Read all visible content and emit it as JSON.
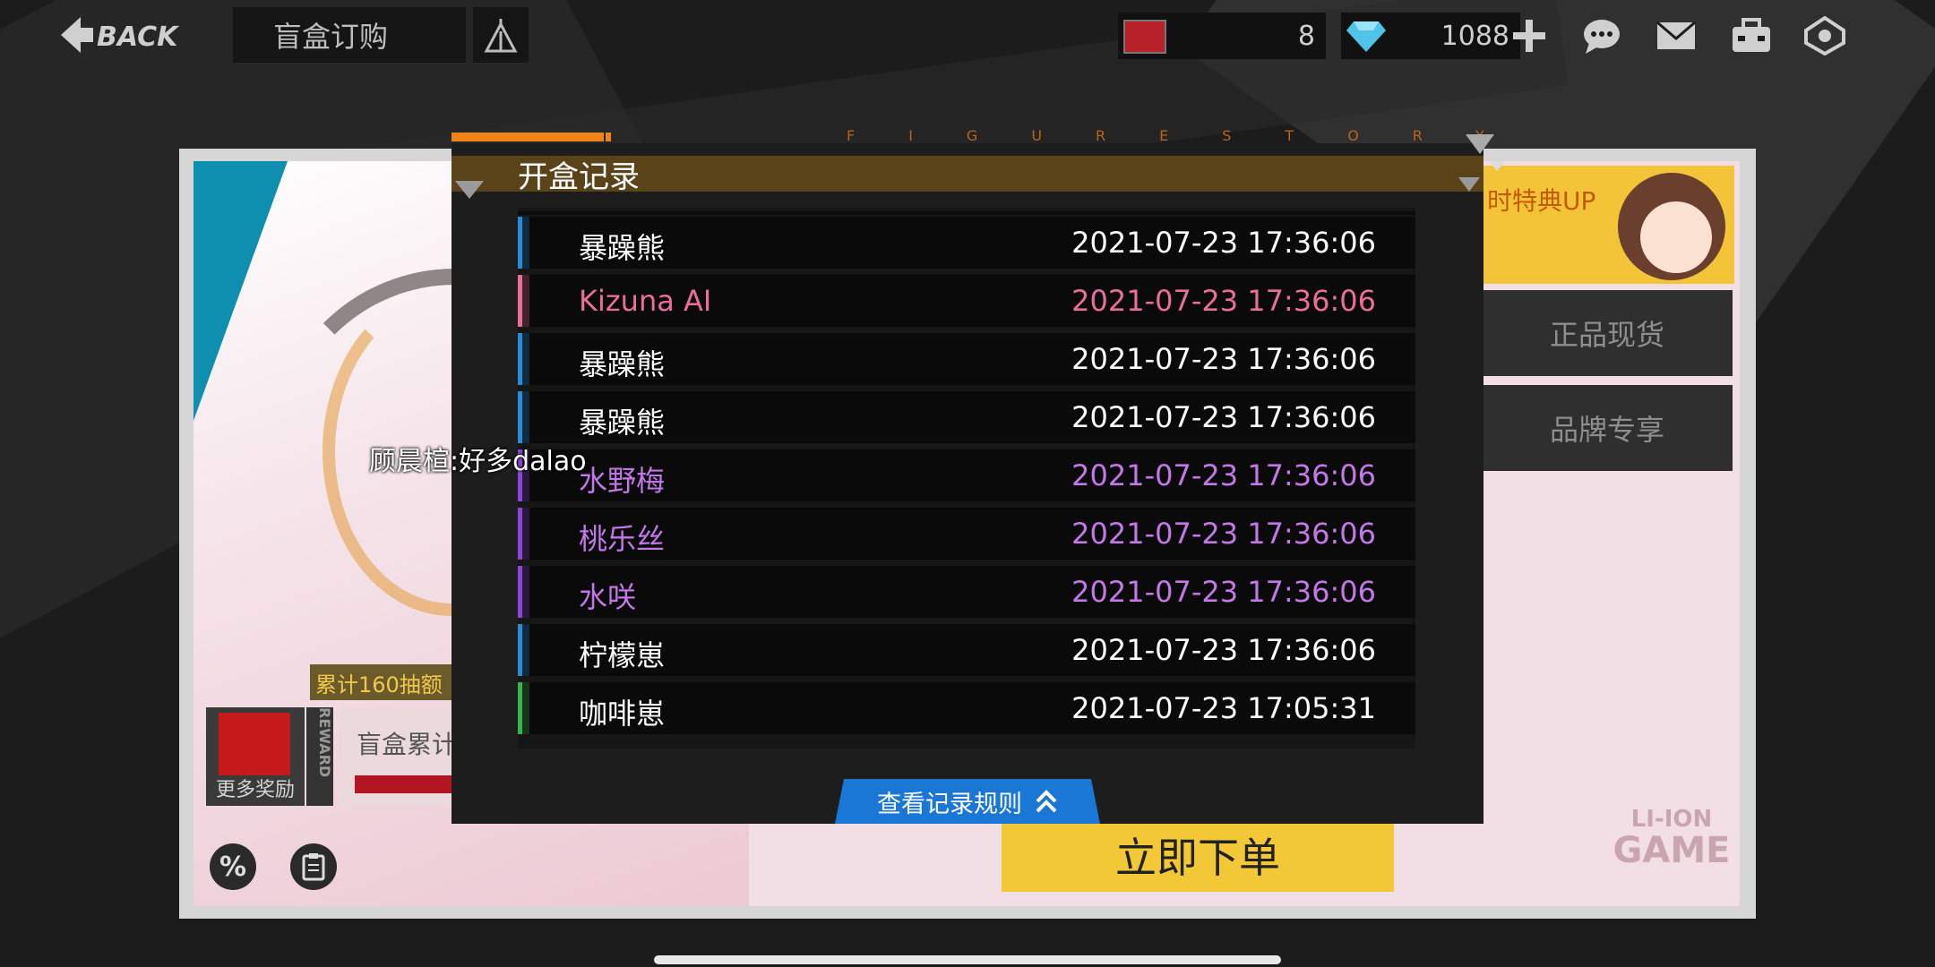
{
  "topbar": {
    "back_label": "BACK",
    "title": "盲盒订购",
    "ticket_count": "8",
    "diamond_count": "1088",
    "icons": [
      "figure-icon",
      "plus-icon",
      "chat-icon",
      "mail-icon",
      "bag-icon",
      "settings-icon"
    ]
  },
  "shop": {
    "right_card_label": "时特典UP",
    "side_btn_1": "正品现货",
    "side_btn_2": "品牌专享",
    "order_btn": "立即下单",
    "brand_logo_line1": "LI-ION",
    "brand_logo_line2": "GAME",
    "reward_tag": "累计160抽额",
    "more_rewards": "更多奖励",
    "reward_vertical": "REWARD",
    "progress_label": "盲盒累计",
    "discount_icon": "%"
  },
  "modal": {
    "title": "开盒记录",
    "brand_strip": "FIGURESTORY",
    "rule_button": "查看记录规则",
    "rows": [
      {
        "name": "暴躁熊",
        "time": "2021-07-23 17:36:06",
        "color": "#ffffff",
        "stripe": "#2a8ad6"
      },
      {
        "name": "Kizuna AI",
        "time": "2021-07-23 17:36:06",
        "color": "#ea6d9a",
        "stripe": "#e86f96"
      },
      {
        "name": "暴躁熊",
        "time": "2021-07-23 17:36:06",
        "color": "#ffffff",
        "stripe": "#2a8ad6"
      },
      {
        "name": "暴躁熊",
        "time": "2021-07-23 17:36:06",
        "color": "#ffffff",
        "stripe": "#2a8ad6"
      },
      {
        "name": "水野梅",
        "time": "2021-07-23 17:36:06",
        "color": "#c477e8",
        "stripe": "#8e45d6"
      },
      {
        "name": "桃乐丝",
        "time": "2021-07-23 17:36:06",
        "color": "#c477e8",
        "stripe": "#8e45d6"
      },
      {
        "name": "水咲",
        "time": "2021-07-23 17:36:06",
        "color": "#c477e8",
        "stripe": "#8e45d6"
      },
      {
        "name": "柠檬崽",
        "time": "2021-07-23 17:36:06",
        "color": "#ffffff",
        "stripe": "#2a8ad6"
      },
      {
        "name": "咖啡崽",
        "time": "2021-07-23 17:05:31",
        "color": "#ffffff",
        "stripe": "#3bb34a"
      }
    ]
  },
  "chat": {
    "message": "顾晨楦:好多dalao"
  }
}
